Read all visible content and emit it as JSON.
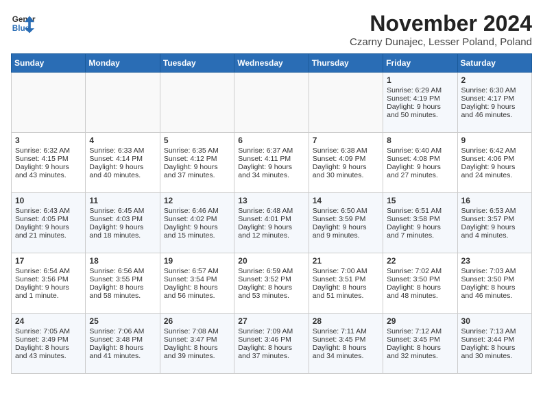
{
  "header": {
    "logo_line1": "General",
    "logo_line2": "Blue",
    "month": "November 2024",
    "location": "Czarny Dunajec, Lesser Poland, Poland"
  },
  "weekdays": [
    "Sunday",
    "Monday",
    "Tuesday",
    "Wednesday",
    "Thursday",
    "Friday",
    "Saturday"
  ],
  "weeks": [
    [
      {
        "day": "",
        "info": ""
      },
      {
        "day": "",
        "info": ""
      },
      {
        "day": "",
        "info": ""
      },
      {
        "day": "",
        "info": ""
      },
      {
        "day": "",
        "info": ""
      },
      {
        "day": "1",
        "info": "Sunrise: 6:29 AM\nSunset: 4:19 PM\nDaylight: 9 hours\nand 50 minutes."
      },
      {
        "day": "2",
        "info": "Sunrise: 6:30 AM\nSunset: 4:17 PM\nDaylight: 9 hours\nand 46 minutes."
      }
    ],
    [
      {
        "day": "3",
        "info": "Sunrise: 6:32 AM\nSunset: 4:15 PM\nDaylight: 9 hours\nand 43 minutes."
      },
      {
        "day": "4",
        "info": "Sunrise: 6:33 AM\nSunset: 4:14 PM\nDaylight: 9 hours\nand 40 minutes."
      },
      {
        "day": "5",
        "info": "Sunrise: 6:35 AM\nSunset: 4:12 PM\nDaylight: 9 hours\nand 37 minutes."
      },
      {
        "day": "6",
        "info": "Sunrise: 6:37 AM\nSunset: 4:11 PM\nDaylight: 9 hours\nand 34 minutes."
      },
      {
        "day": "7",
        "info": "Sunrise: 6:38 AM\nSunset: 4:09 PM\nDaylight: 9 hours\nand 30 minutes."
      },
      {
        "day": "8",
        "info": "Sunrise: 6:40 AM\nSunset: 4:08 PM\nDaylight: 9 hours\nand 27 minutes."
      },
      {
        "day": "9",
        "info": "Sunrise: 6:42 AM\nSunset: 4:06 PM\nDaylight: 9 hours\nand 24 minutes."
      }
    ],
    [
      {
        "day": "10",
        "info": "Sunrise: 6:43 AM\nSunset: 4:05 PM\nDaylight: 9 hours\nand 21 minutes."
      },
      {
        "day": "11",
        "info": "Sunrise: 6:45 AM\nSunset: 4:03 PM\nDaylight: 9 hours\nand 18 minutes."
      },
      {
        "day": "12",
        "info": "Sunrise: 6:46 AM\nSunset: 4:02 PM\nDaylight: 9 hours\nand 15 minutes."
      },
      {
        "day": "13",
        "info": "Sunrise: 6:48 AM\nSunset: 4:01 PM\nDaylight: 9 hours\nand 12 minutes."
      },
      {
        "day": "14",
        "info": "Sunrise: 6:50 AM\nSunset: 3:59 PM\nDaylight: 9 hours\nand 9 minutes."
      },
      {
        "day": "15",
        "info": "Sunrise: 6:51 AM\nSunset: 3:58 PM\nDaylight: 9 hours\nand 7 minutes."
      },
      {
        "day": "16",
        "info": "Sunrise: 6:53 AM\nSunset: 3:57 PM\nDaylight: 9 hours\nand 4 minutes."
      }
    ],
    [
      {
        "day": "17",
        "info": "Sunrise: 6:54 AM\nSunset: 3:56 PM\nDaylight: 9 hours\nand 1 minute."
      },
      {
        "day": "18",
        "info": "Sunrise: 6:56 AM\nSunset: 3:55 PM\nDaylight: 8 hours\nand 58 minutes."
      },
      {
        "day": "19",
        "info": "Sunrise: 6:57 AM\nSunset: 3:54 PM\nDaylight: 8 hours\nand 56 minutes."
      },
      {
        "day": "20",
        "info": "Sunrise: 6:59 AM\nSunset: 3:52 PM\nDaylight: 8 hours\nand 53 minutes."
      },
      {
        "day": "21",
        "info": "Sunrise: 7:00 AM\nSunset: 3:51 PM\nDaylight: 8 hours\nand 51 minutes."
      },
      {
        "day": "22",
        "info": "Sunrise: 7:02 AM\nSunset: 3:50 PM\nDaylight: 8 hours\nand 48 minutes."
      },
      {
        "day": "23",
        "info": "Sunrise: 7:03 AM\nSunset: 3:50 PM\nDaylight: 8 hours\nand 46 minutes."
      }
    ],
    [
      {
        "day": "24",
        "info": "Sunrise: 7:05 AM\nSunset: 3:49 PM\nDaylight: 8 hours\nand 43 minutes."
      },
      {
        "day": "25",
        "info": "Sunrise: 7:06 AM\nSunset: 3:48 PM\nDaylight: 8 hours\nand 41 minutes."
      },
      {
        "day": "26",
        "info": "Sunrise: 7:08 AM\nSunset: 3:47 PM\nDaylight: 8 hours\nand 39 minutes."
      },
      {
        "day": "27",
        "info": "Sunrise: 7:09 AM\nSunset: 3:46 PM\nDaylight: 8 hours\nand 37 minutes."
      },
      {
        "day": "28",
        "info": "Sunrise: 7:11 AM\nSunset: 3:45 PM\nDaylight: 8 hours\nand 34 minutes."
      },
      {
        "day": "29",
        "info": "Sunrise: 7:12 AM\nSunset: 3:45 PM\nDaylight: 8 hours\nand 32 minutes."
      },
      {
        "day": "30",
        "info": "Sunrise: 7:13 AM\nSunset: 3:44 PM\nDaylight: 8 hours\nand 30 minutes."
      }
    ]
  ]
}
